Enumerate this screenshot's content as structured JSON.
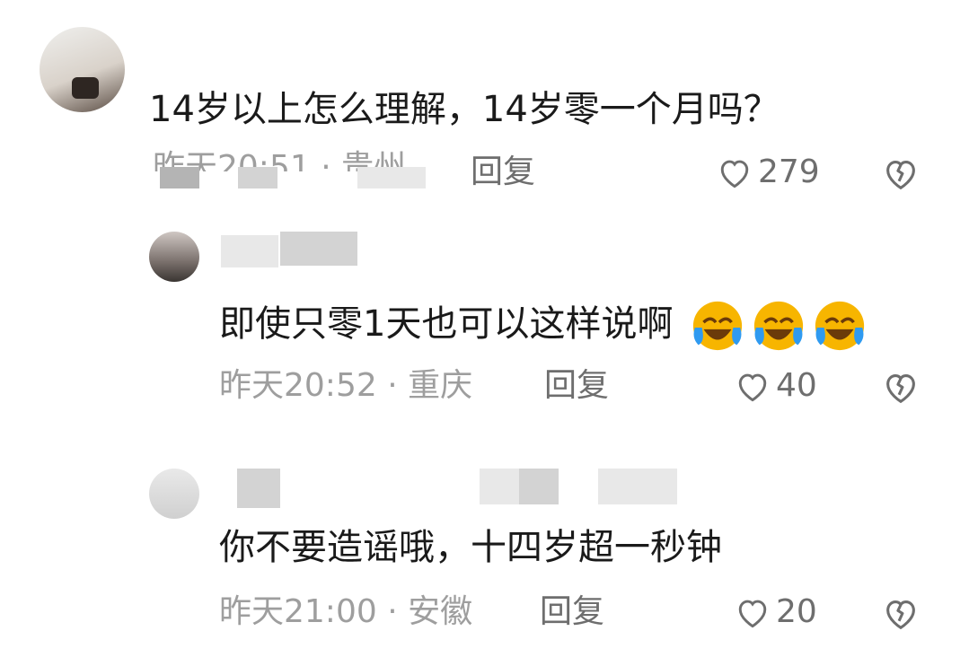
{
  "comments": [
    {
      "text": "14岁以上怎么理解，14岁零一个月吗？",
      "meta": "昨天20:51 · 贵州",
      "reply_label": "回复",
      "likes": "279"
    },
    {
      "text": "即使只零1天也可以这样说啊",
      "emoji": [
        "laugh-cry-emoji",
        "laugh-cry-emoji",
        "laugh-cry-emoji"
      ],
      "meta": "昨天20:52 · 重庆",
      "reply_label": "回复",
      "likes": "40"
    },
    {
      "text": "你不要造谣哦，十四岁超一秒钟",
      "meta": "昨天21:00 · 安徽",
      "reply_label": "回复",
      "likes": "20"
    }
  ],
  "colors": {
    "text": "#1a1a1a",
    "meta": "#9e9e9e",
    "action": "#6e6e6e",
    "emoji": "#f7b500"
  }
}
